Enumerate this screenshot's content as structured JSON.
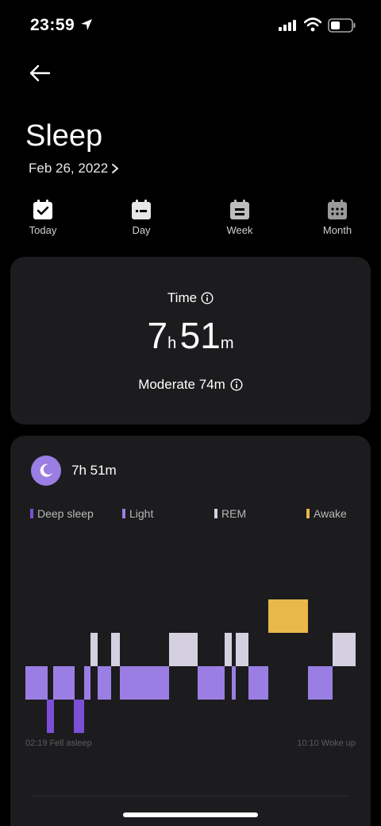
{
  "status_bar": {
    "time": "23:59",
    "icons": [
      "location-arrow-icon",
      "signal-icon",
      "wifi-icon",
      "battery-icon"
    ]
  },
  "header": {
    "title": "Sleep",
    "date": "Feb 26, 2022"
  },
  "tabs": [
    {
      "label": "Today",
      "icon": "calendar-check-icon"
    },
    {
      "label": "Day",
      "icon": "calendar-day-icon"
    },
    {
      "label": "Week",
      "icon": "calendar-week-icon"
    },
    {
      "label": "Month",
      "icon": "calendar-month-icon"
    }
  ],
  "time_card": {
    "label": "Time",
    "hours": "7",
    "hours_unit": "h",
    "minutes": "51",
    "minutes_unit": "m",
    "moderate": "Moderate 74m"
  },
  "chart_card": {
    "duration": "7h 51m",
    "start_label": "02:19 Fell asleep",
    "end_label": "10:10 Woke up"
  },
  "chart_data": {
    "type": "hypnogram",
    "legend": [
      {
        "name": "Deep sleep",
        "color": "#7b4fd6"
      },
      {
        "name": "Light",
        "color": "#9b7ee3"
      },
      {
        "name": "REM",
        "color": "#d5d0e0"
      },
      {
        "name": "Awake",
        "color": "#e8b84a"
      }
    ],
    "start_time": "02:19",
    "end_time": "10:10"
  },
  "colors": {
    "accent": "#9b7ee3",
    "card": "#1c1c1e",
    "awake": "#e8b84a"
  }
}
